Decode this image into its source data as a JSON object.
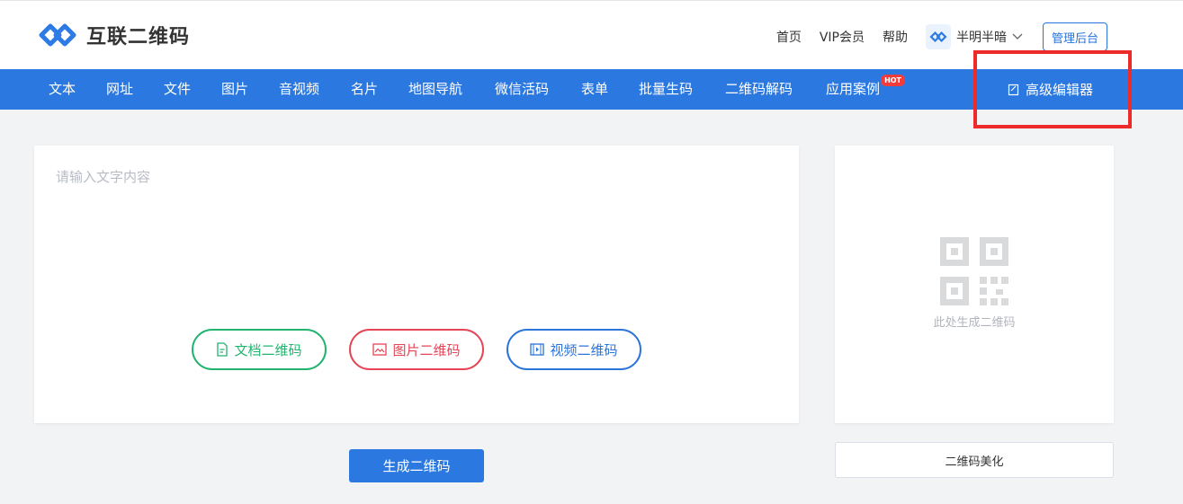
{
  "header": {
    "brand": "互联二维码",
    "links": [
      "首页",
      "VIP会员",
      "帮助"
    ],
    "user_name": "半明半暗",
    "admin_label": "管理后台"
  },
  "nav": {
    "items": [
      "文本",
      "网址",
      "文件",
      "图片",
      "音视频",
      "名片",
      "地图导航",
      "微信活码",
      "表单",
      "批量生码",
      "二维码解码",
      "应用案例"
    ],
    "hot_badge": "HOT",
    "advanced_editor": "高级编辑器"
  },
  "editor": {
    "placeholder": "请输入文字内容",
    "value": "",
    "doc_qr": "文档二维码",
    "img_qr": "图片二维码",
    "video_qr": "视频二维码"
  },
  "actions": {
    "generate": "生成二维码",
    "beautify": "二维码美化"
  },
  "qr_preview": {
    "hint": "此处生成二维码"
  },
  "colors": {
    "primary": "#2b79e0",
    "green": "#22b46e",
    "red": "#e54556",
    "highlight": "#ee2b2b"
  }
}
